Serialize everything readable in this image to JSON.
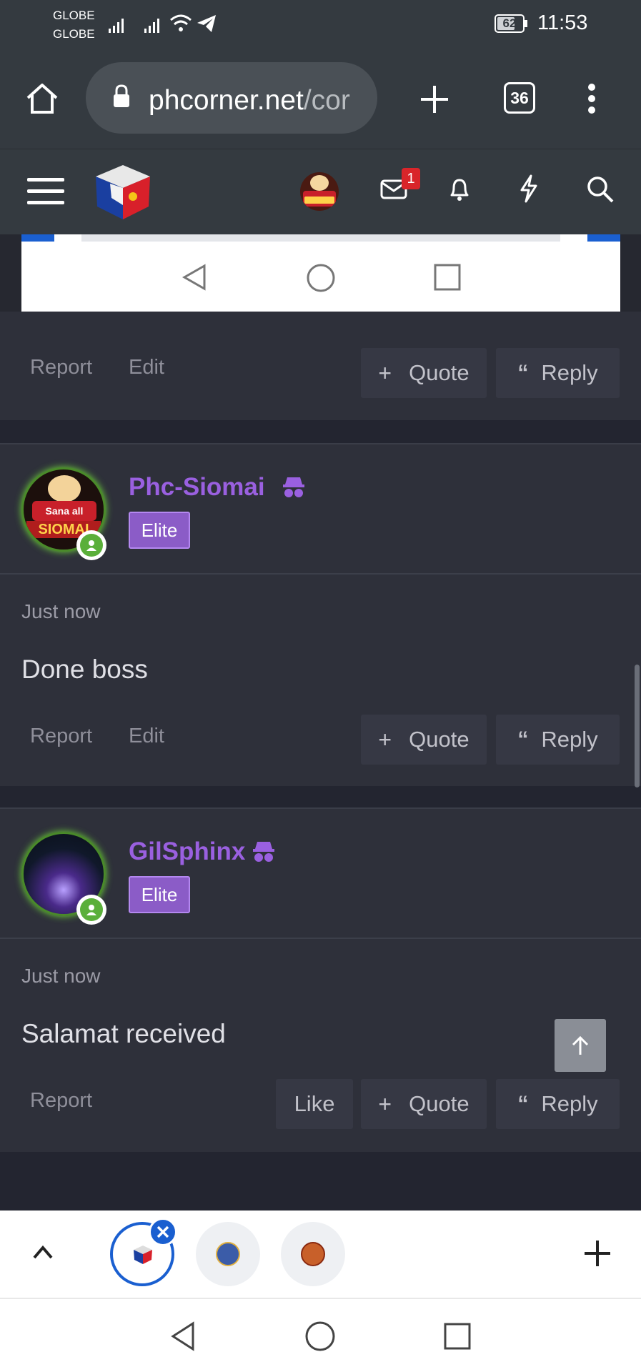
{
  "status_bar": {
    "carrier1": "GLOBE",
    "carrier2": "GLOBE",
    "battery": "62",
    "time": "11:53"
  },
  "browser": {
    "url_main": "phcorner.net",
    "url_rest": "/cor",
    "tab_count": "36"
  },
  "header": {
    "mail_badge": "1"
  },
  "post_top": {
    "actions": {
      "report": "Report",
      "edit": "Edit",
      "quote": "Quote",
      "reply": "Reply"
    }
  },
  "posts": [
    {
      "username": "Phc-Siomai",
      "badge": "Elite",
      "time": "Just now",
      "content": "Done boss",
      "actions": {
        "report": "Report",
        "edit": "Edit",
        "quote": "Quote",
        "reply": "Reply"
      }
    },
    {
      "username": "GilSphinx",
      "badge": "Elite",
      "time": "Just now",
      "content": "Salamat received",
      "actions": {
        "report": "Report",
        "like": "Like",
        "quote": "Quote",
        "reply": "Reply"
      }
    }
  ],
  "avatar_text": {
    "line1": "Sana all",
    "line2": "SIOMAI"
  },
  "colors": {
    "username": "#9a60e0",
    "badge": "#8b5cc7",
    "online": "#5aaf3a",
    "accent_blue": "#1a5fd0"
  }
}
